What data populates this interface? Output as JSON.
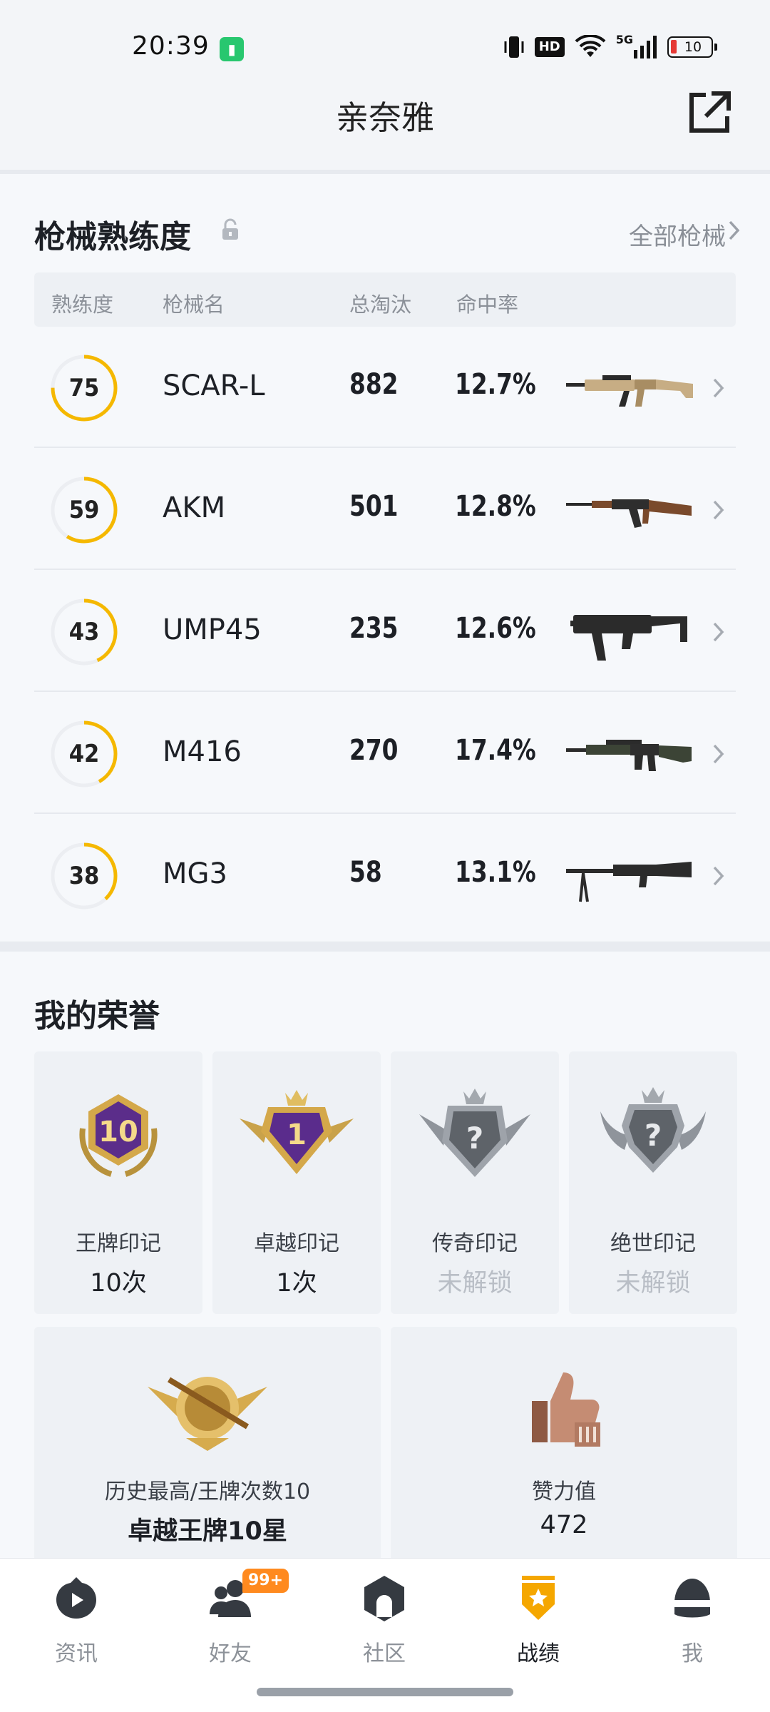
{
  "status_bar": {
    "time": "20:39",
    "network": "5G",
    "hd": "HD",
    "battery": "10"
  },
  "header": {
    "title": "亲奈雅"
  },
  "weapons": {
    "title": "枪械熟练度",
    "all_link": "全部枪械",
    "columns": [
      "熟练度",
      "枪械名",
      "总淘汰",
      "命中率"
    ],
    "rows": [
      {
        "proficiency": "75",
        "proficiency_pct": 0.75,
        "name": "SCAR-L",
        "kills": "882",
        "accuracy": "12.7%",
        "icon": "scar-l-rifle"
      },
      {
        "proficiency": "59",
        "proficiency_pct": 0.59,
        "name": "AKM",
        "kills": "501",
        "accuracy": "12.8%",
        "icon": "akm-rifle"
      },
      {
        "proficiency": "43",
        "proficiency_pct": 0.43,
        "name": "UMP45",
        "kills": "235",
        "accuracy": "12.6%",
        "icon": "ump45-smg"
      },
      {
        "proficiency": "42",
        "proficiency_pct": 0.42,
        "name": "M416",
        "kills": "270",
        "accuracy": "17.4%",
        "icon": "m416-rifle"
      },
      {
        "proficiency": "38",
        "proficiency_pct": 0.38,
        "name": "MG3",
        "kills": "58",
        "accuracy": "13.1%",
        "icon": "mg3-machine-gun"
      }
    ]
  },
  "honors": {
    "title": "我的荣誉",
    "marks": [
      {
        "label": "王牌印记",
        "value": "10次",
        "badge_text": "10",
        "locked": false
      },
      {
        "label": "卓越印记",
        "value": "1次",
        "badge_text": "1",
        "locked": false
      },
      {
        "label": "传奇印记",
        "value": "未解锁",
        "badge_text": "?",
        "locked": true
      },
      {
        "label": "绝世印记",
        "value": "未解锁",
        "badge_text": "?",
        "locked": true
      }
    ],
    "highest": {
      "label": "历史最高/王牌次数10",
      "value": "卓越王牌10星"
    },
    "likes": {
      "label": "赞力值",
      "value": "472"
    }
  },
  "nav": {
    "items": [
      {
        "label": "资讯",
        "active": false
      },
      {
        "label": "好友",
        "active": false,
        "badge": "99+"
      },
      {
        "label": "社区",
        "active": false
      },
      {
        "label": "战绩",
        "active": true
      },
      {
        "label": "我",
        "active": false
      }
    ]
  },
  "colors": {
    "ring": "#f5b800",
    "ring_track": "#eceef2",
    "active_nav": "#f5a700"
  }
}
